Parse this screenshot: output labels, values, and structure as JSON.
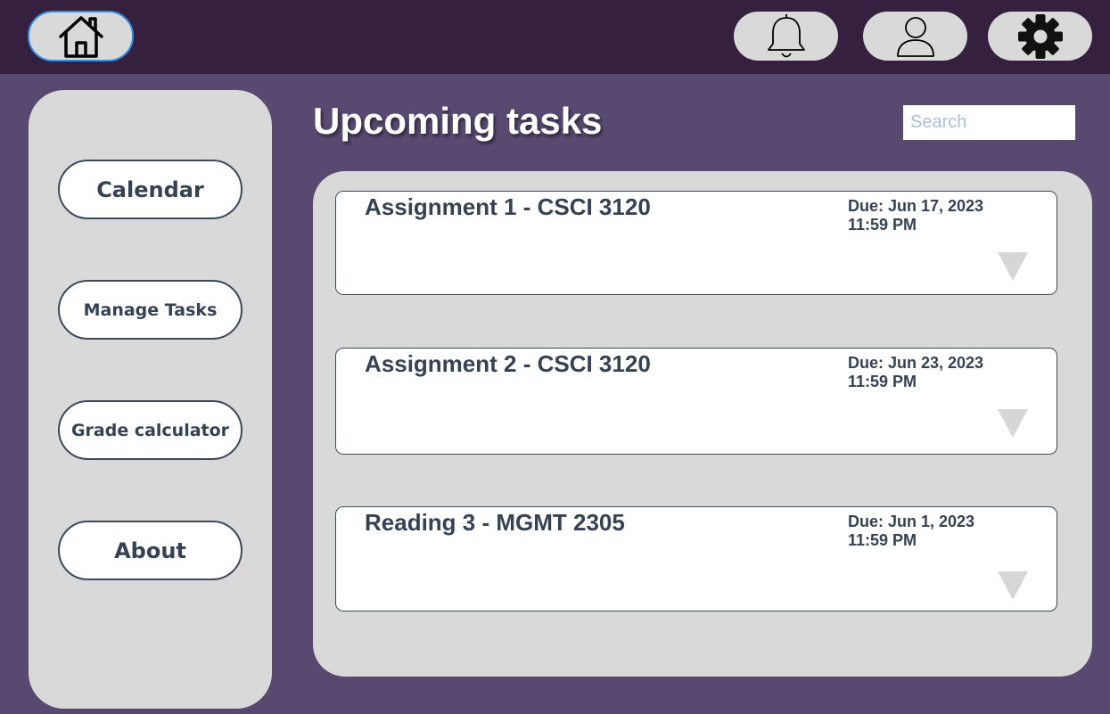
{
  "topbar": {
    "icons": [
      "home-icon",
      "bell-icon",
      "user-icon",
      "gear-icon"
    ]
  },
  "sidebar": {
    "items": [
      {
        "label": "Calendar"
      },
      {
        "label": "Manage Tasks"
      },
      {
        "label": "Grade calculator"
      },
      {
        "label": "About"
      }
    ]
  },
  "main": {
    "title": "Upcoming tasks",
    "search_placeholder": "Search",
    "tasks": [
      {
        "title": "Assignment 1 - CSCI 3120",
        "due_date": "Due: Jun 17, 2023",
        "due_time": "11:59 PM",
        "expand_icon": "triangle-down-icon"
      },
      {
        "title": "Assignment 2 - CSCI 3120",
        "due_date": "Due: Jun 23, 2023",
        "due_time": "11:59 PM",
        "expand_icon": "triangle-down-icon"
      },
      {
        "title": "Reading 3 - MGMT 2305",
        "due_date": "Due: Jun 1, 2023",
        "due_time": "11:59 PM",
        "expand_icon": "triangle-down-icon"
      }
    ]
  },
  "colors": {
    "background": "#574970",
    "topbar": "#35213f",
    "panel": "#d9d9d9",
    "text": "#354253",
    "home_border": "#2f8de4"
  }
}
